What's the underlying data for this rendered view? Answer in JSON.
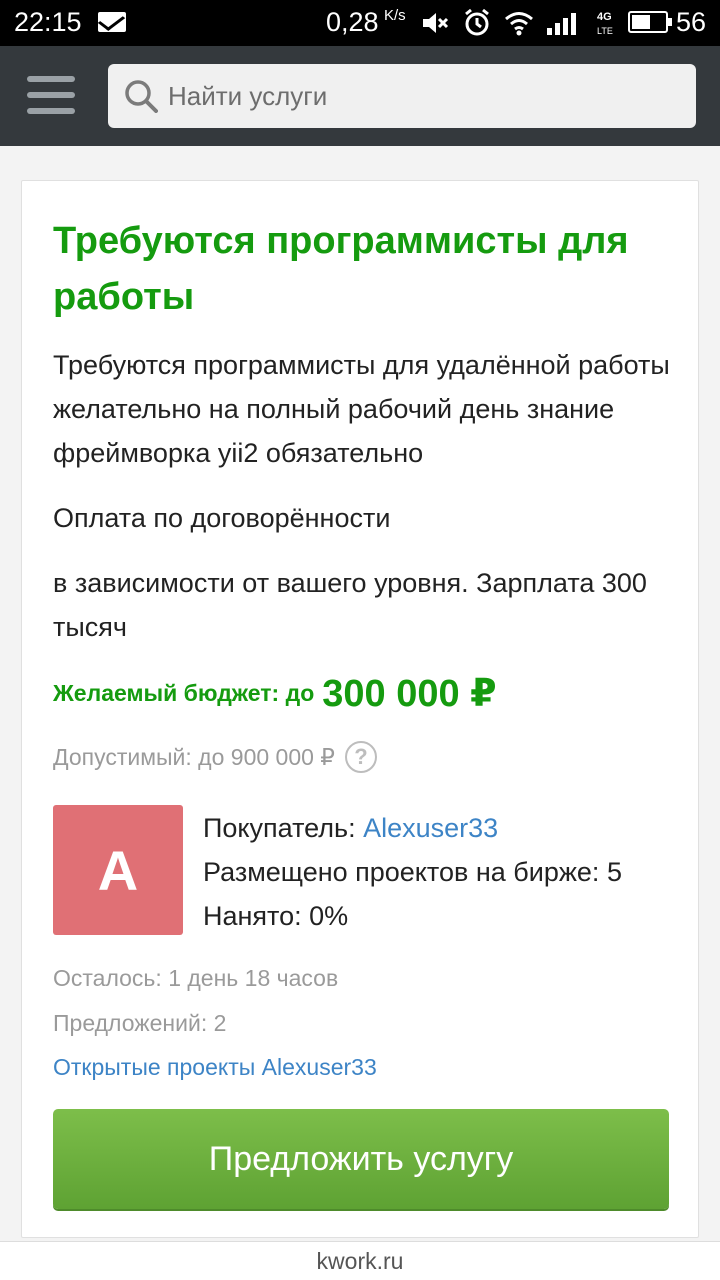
{
  "status_bar": {
    "time": "22:15",
    "net_speed": "0,28",
    "net_unit": "K/s",
    "network_type": "4G LTE",
    "battery_level": "56",
    "battery_fraction": 0.56,
    "icons": [
      "mail-icon",
      "mute-icon",
      "alarm-icon",
      "wifi-icon",
      "signal-icon",
      "battery-icon"
    ]
  },
  "header": {
    "menu_icon": "hamburger-icon",
    "search": {
      "placeholder": "Найти услуги",
      "value": ""
    }
  },
  "project": {
    "title": "Требуются программисты для работы",
    "description": [
      "Требуются программисты для удалённой работы желательно на полный рабочий день знание фреймворка yii2 обязательно",
      "Оплата по договорённости",
      "в зависимости от вашего уровня. Зарплата 300 тысяч"
    ],
    "budget_label": "Желаемый бюджет: до",
    "budget_value": "300 000 ₽",
    "allowed": "Допустимый: до 900 000 ₽",
    "help": "?"
  },
  "buyer": {
    "avatar_letter": "A",
    "buyer_label": "Покупатель:",
    "buyer_name": "Alexuser33",
    "projects_label": "Размещено проектов на бирже:",
    "projects_count": "5",
    "hired_label": "Нанято:",
    "hired_value": "0%"
  },
  "meta": {
    "time_left": "Осталось: 1 день 18 часов",
    "offers": "Предложений: 2",
    "open_projects_link": "Открытые проекты Alexuser33"
  },
  "actions": {
    "offer_button": "Предложить услугу"
  },
  "footer": {
    "site": "kwork.ru"
  },
  "colors": {
    "accent_green": "#159b0f",
    "button_green": "#6bb13c",
    "link_blue": "#3d84c6",
    "avatar_red": "#e07075",
    "header_bg": "#34393d"
  }
}
